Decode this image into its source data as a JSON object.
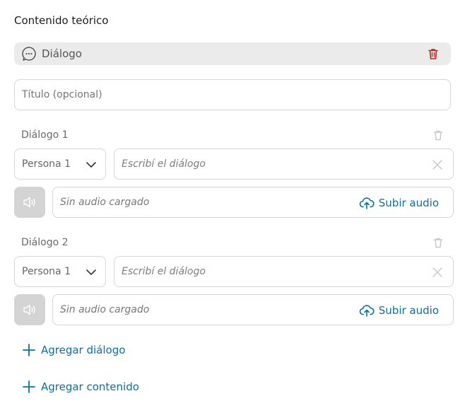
{
  "section": {
    "title": "Contenido teórico"
  },
  "block": {
    "type_label": "Diálogo"
  },
  "title_field": {
    "placeholder": "Título (opcional)"
  },
  "dialogs": [
    {
      "label": "Diálogo 1",
      "persona": "Persona 1",
      "dialog_placeholder": "Escribí el diálogo",
      "audio_status": "Sin audio cargado",
      "upload_label": "Subir audio"
    },
    {
      "label": "Diálogo 2",
      "persona": "Persona 1",
      "dialog_placeholder": "Escribí el diálogo",
      "audio_status": "Sin audio cargado",
      "upload_label": "Subir audio"
    }
  ],
  "actions": {
    "add_dialog": "Agregar diálogo",
    "add_content": "Agregar contenido"
  },
  "icons": {
    "block": "chat-bubble-icon",
    "delete_block": "trash-icon",
    "delete_dialog": "trash-icon",
    "select": "chevron-down-icon",
    "clear": "close-icon",
    "audio": "speaker-icon",
    "upload": "cloud-upload-icon",
    "add": "plus-icon"
  },
  "colors": {
    "accent": "#0b6ea3",
    "danger": "#b3261e",
    "header_bg": "#ebebeb",
    "audio_button_bg": "#d4d4d4"
  }
}
